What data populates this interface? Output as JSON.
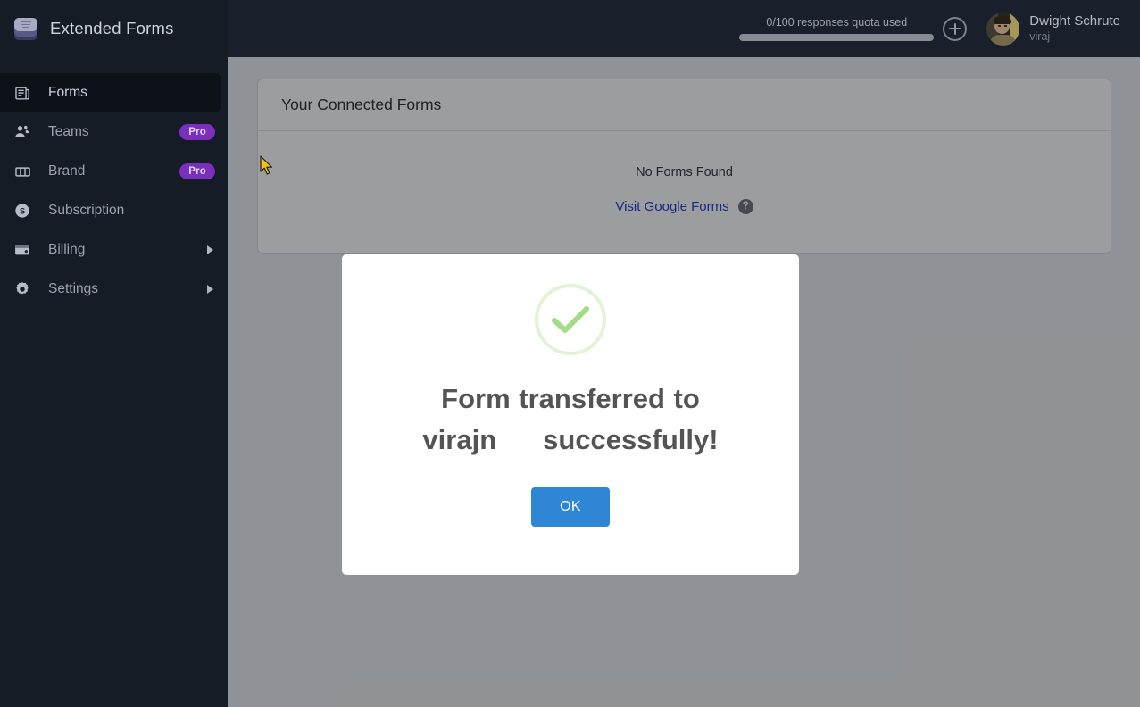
{
  "app": {
    "brand_title": "Extended Forms",
    "logo_icon": "stacked-layers-icon"
  },
  "header": {
    "quota_label": "0/100 responses quota used",
    "quota_used": 0,
    "quota_total": 100,
    "quota_percent": 0,
    "add_icon": "plus-circle-icon",
    "user": {
      "name": "Dwight Schrute",
      "handle": "viraj",
      "avatar_icon": "user-avatar"
    }
  },
  "sidebar": {
    "items": [
      {
        "label": "Forms",
        "icon": "forms-icon",
        "active": true,
        "badge": null,
        "caret": false
      },
      {
        "label": "Teams",
        "icon": "teams-icon",
        "active": false,
        "badge": "Pro",
        "caret": false
      },
      {
        "label": "Brand",
        "icon": "brand-icon",
        "active": false,
        "badge": "Pro",
        "caret": false
      },
      {
        "label": "Subscription",
        "icon": "subscription-icon",
        "active": false,
        "badge": null,
        "caret": false
      },
      {
        "label": "Billing",
        "icon": "billing-icon",
        "active": false,
        "badge": null,
        "caret": true
      },
      {
        "label": "Settings",
        "icon": "settings-icon",
        "active": false,
        "badge": null,
        "caret": true
      }
    ]
  },
  "main": {
    "panel_title": "Your Connected Forms",
    "empty_text": "No Forms Found",
    "empty_link": "Visit Google Forms",
    "help_icon_char": "?"
  },
  "modal": {
    "icon": "success-check-icon",
    "title_line1": "Form transferred to",
    "title_line2_name": "virajn",
    "title_line2_tail": "successfully!",
    "ok_label": "OK"
  },
  "colors": {
    "sidebar_bg": "#161c26",
    "header_bg": "#1b2330",
    "pro_badge": "#7b2fbe",
    "link": "#1a37d8",
    "ok_button": "#2f86d4",
    "success_green": "#a5dc86"
  }
}
